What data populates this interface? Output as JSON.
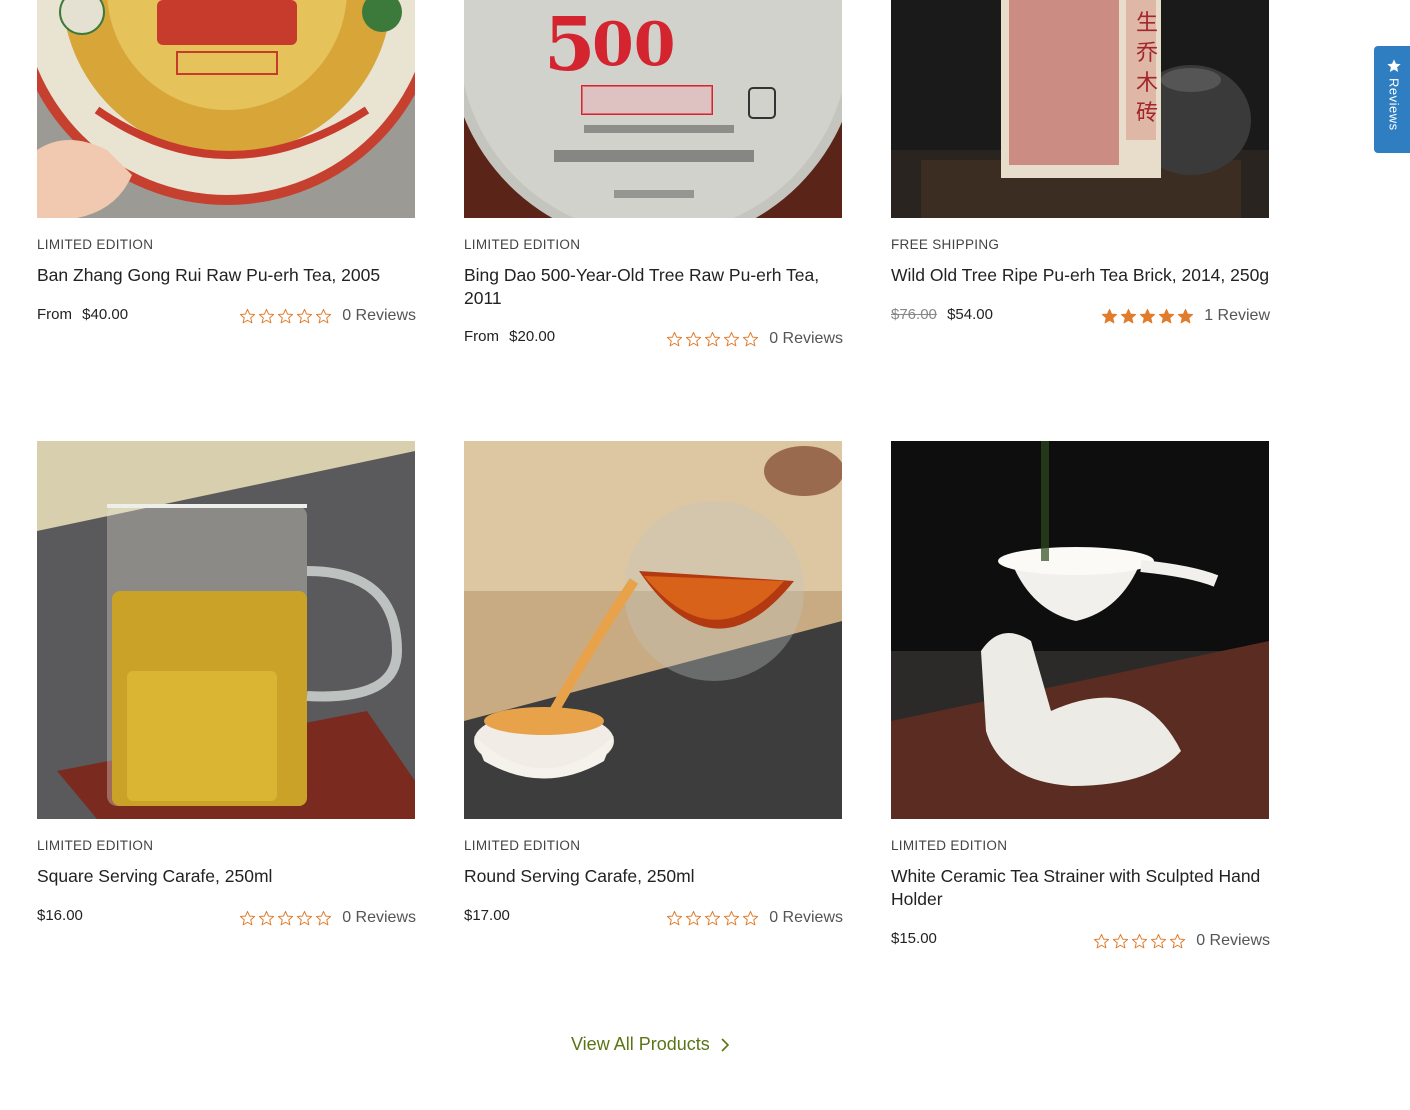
{
  "products": [
    {
      "tag": "LIMITED EDITION",
      "title": "Ban Zhang Gong Rui Raw Pu-erh Tea, 2005",
      "price_prefix": "From",
      "price": "$40.00",
      "old_price": "",
      "rating": 0,
      "reviews": "0 Reviews",
      "image": "pu-erh-cake-red-wrapper"
    },
    {
      "tag": "LIMITED EDITION",
      "title": "Bing Dao 500-Year-Old Tree Raw Pu-erh Tea, 2011",
      "price_prefix": "From",
      "price": "$20.00",
      "old_price": "",
      "rating": 0,
      "reviews": "0 Reviews",
      "image": "pu-erh-cake-500-years"
    },
    {
      "tag": "FREE SHIPPING",
      "title": "Wild Old Tree Ripe Pu-erh Tea Brick, 2014, 250g",
      "price_prefix": "",
      "price": "$54.00",
      "old_price": "$76.00",
      "rating": 5,
      "reviews": "1 Review",
      "image": "pu-erh-brick-with-iron-teapot"
    },
    {
      "tag": "LIMITED EDITION",
      "title": "Square Serving Carafe, 250ml",
      "price_prefix": "",
      "price": "$16.00",
      "old_price": "",
      "rating": 0,
      "reviews": "0 Reviews",
      "image": "square-glass-carafe"
    },
    {
      "tag": "LIMITED EDITION",
      "title": "Round Serving Carafe, 250ml",
      "price_prefix": "",
      "price": "$17.00",
      "old_price": "",
      "rating": 0,
      "reviews": "0 Reviews",
      "image": "round-glass-carafe-pouring"
    },
    {
      "tag": "LIMITED EDITION",
      "title": "White Ceramic Tea Strainer with Sculpted Hand Holder",
      "price_prefix": "",
      "price": "$15.00",
      "old_price": "",
      "rating": 0,
      "reviews": "0 Reviews",
      "image": "white-ceramic-strainer-hand"
    }
  ],
  "view_all": "View All Products",
  "reviews_tab": "Reviews",
  "colors": {
    "star": "#e07c2c",
    "link": "#5a7417",
    "reviews_tab": "#2f7ec2"
  }
}
